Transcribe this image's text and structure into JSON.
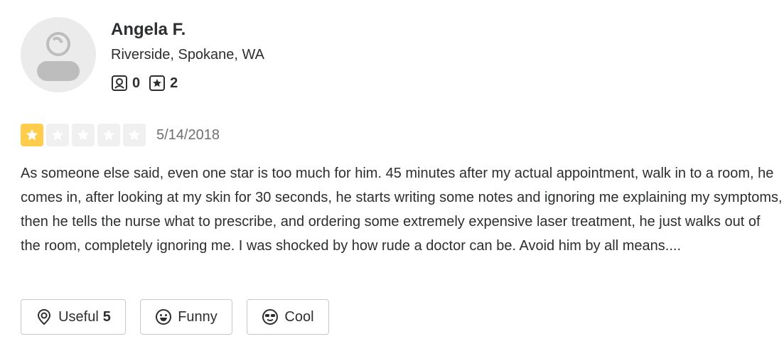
{
  "user": {
    "name": "Angela F.",
    "location": "Riverside, Spokane, WA",
    "friends_count": "0",
    "reviews_count": "2"
  },
  "review": {
    "rating": 1,
    "max_rating": 5,
    "date": "5/14/2018",
    "text": "As someone else said, even one star is too much for him. 45 minutes after my actual appointment, walk in to a room, he comes in, after looking at my skin for 30 seconds, he starts writing some notes and ignoring me explaining my symptoms, then he tells the nurse what to prescribe, and ordering some extremely expensive laser treatment, he just walks out of the room, completely ignoring me. I was shocked by how rude a doctor can be. Avoid him by all means...."
  },
  "reactions": {
    "useful_label": "Useful",
    "useful_count": "5",
    "funny_label": "Funny",
    "cool_label": "Cool"
  },
  "colors": {
    "star_filled": "#ffcc4b",
    "star_empty": "#f0f0f0",
    "text": "#2d2e2f",
    "muted": "#6e7072"
  }
}
